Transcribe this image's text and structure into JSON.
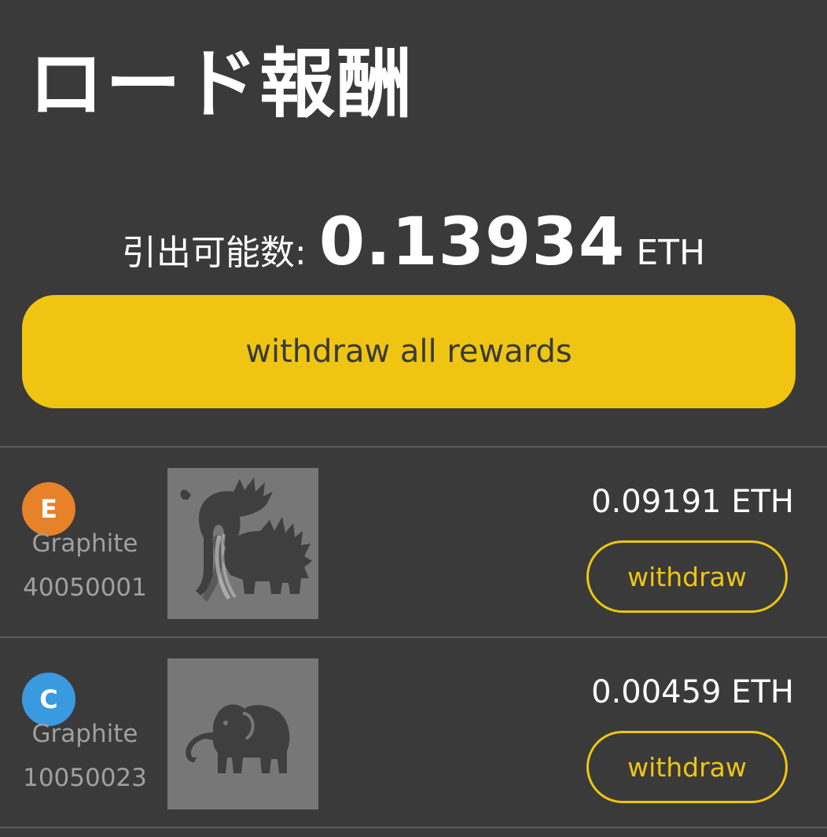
{
  "header": {
    "title": "ロード報酬"
  },
  "balance": {
    "label": "引出可能数:",
    "value": "0.13934",
    "unit": "ETH"
  },
  "actions": {
    "withdraw_all_label": "withdraw all rewards"
  },
  "rewards": [
    {
      "badge_letter": "E",
      "badge_color": "#e7812a",
      "node_type": "Graphite",
      "node_id": "40050001",
      "image_icon": "mammoth-icon",
      "amount": "0.09191 ETH",
      "withdraw_label": "withdraw"
    },
    {
      "badge_letter": "C",
      "badge_color": "#3a9ae0",
      "node_type": "Graphite",
      "node_id": "10050023",
      "image_icon": "elephant-icon",
      "amount": "0.00459 ETH",
      "withdraw_label": "withdraw"
    }
  ],
  "colors": {
    "background": "#3a3a3a",
    "accent": "#efc511",
    "thumbnail_bg": "#777777",
    "muted_text": "#a0a0a0"
  }
}
